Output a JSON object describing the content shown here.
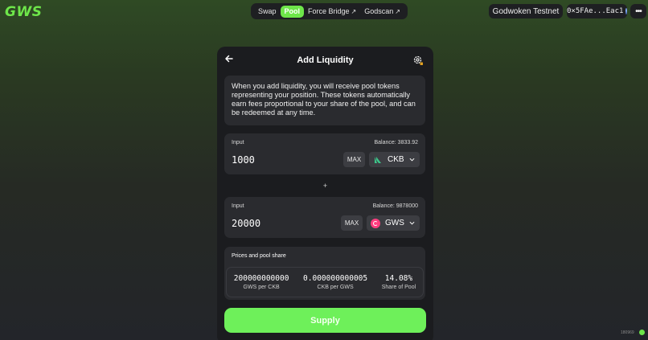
{
  "header": {
    "logo": "GWS",
    "nav": [
      {
        "label": "Swap",
        "external": ""
      },
      {
        "label": "Pool",
        "external": ""
      },
      {
        "label": "Force Bridge",
        "external": "↗"
      },
      {
        "label": "Godscan",
        "external": "↗"
      }
    ],
    "network": "Godwoken Testnet",
    "account": "0×5FAe...Eac1",
    "more": "•••"
  },
  "card": {
    "title": "Add Liquidity",
    "info": "When you add liquidity, you will receive pool tokens representing your position. These tokens automatically earn fees proportional to your share of the pool, and can be redeemed at any time.",
    "input1": {
      "label": "Input",
      "balance": "Balance: 3833.92",
      "value": "1000",
      "max": "MAX",
      "token": "CKB",
      "token_icon": "ckb-icon"
    },
    "plus": "+",
    "input2": {
      "label": "Input",
      "balance": "Balance: 9878000",
      "value": "20000",
      "max": "MAX",
      "token": "GWS",
      "token_icon": "gws-icon"
    },
    "prices": {
      "title": "Prices and pool share",
      "items": [
        {
          "value": "200000000000",
          "label": "GWS per CKB"
        },
        {
          "value": "0.000000000005",
          "label": "CKB per GWS"
        },
        {
          "value": "14.08%",
          "label": "Share of Pool"
        }
      ]
    },
    "supply": "Supply"
  },
  "footer": {
    "block": "180969"
  },
  "colors": {
    "accent": "#6ee64a",
    "card_bg": "#1b1c1f",
    "panel_bg": "#2a2b2f",
    "gws_pink": "#ff3d7f"
  }
}
